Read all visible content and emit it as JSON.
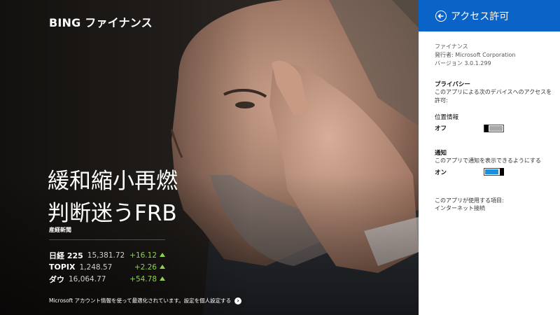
{
  "app": {
    "brand": "BING ファイナンス"
  },
  "hero": {
    "headline_line1": "緩和縮小再燃",
    "headline_line2": "判断迷うFRB",
    "source": "産経新聞"
  },
  "markets": [
    {
      "name": "日経 225",
      "value": "15,381.72",
      "change": "+16.12"
    },
    {
      "name": "TOPIX",
      "value": "1,248.57",
      "change": "+2.26"
    },
    {
      "name": "ダウ",
      "value": "16,064.77",
      "change": "+54.78"
    }
  ],
  "footer": {
    "note": "Microsoft アカウント情報を使って最適化されています。設定を個人設定する"
  },
  "flyout": {
    "title": "アクセス許可",
    "app_name": "ファイナンス",
    "publisher": "発行者: Microsoft Corporation",
    "version": "バージョン 3.0.1.299",
    "privacy_title": "プライバシー",
    "privacy_desc": "このアプリによる次のデバイスへのアクセスを許可:",
    "location_label": "位置情報",
    "location_state": "オフ",
    "notify_title": "通知",
    "notify_desc": "このアプリで通知を表示できるようにする",
    "notify_state": "オン",
    "uses_title": "このアプリが使用する項目:",
    "uses_item": "インターネット接続"
  },
  "colors": {
    "accent": "#0a63c7",
    "toggle_on": "#1a8fe0",
    "positive": "#8fd14f"
  },
  "icons": {
    "back": "back-arrow-icon",
    "footer": "chevron-right-circle-icon",
    "up": "triangle-up-icon"
  }
}
